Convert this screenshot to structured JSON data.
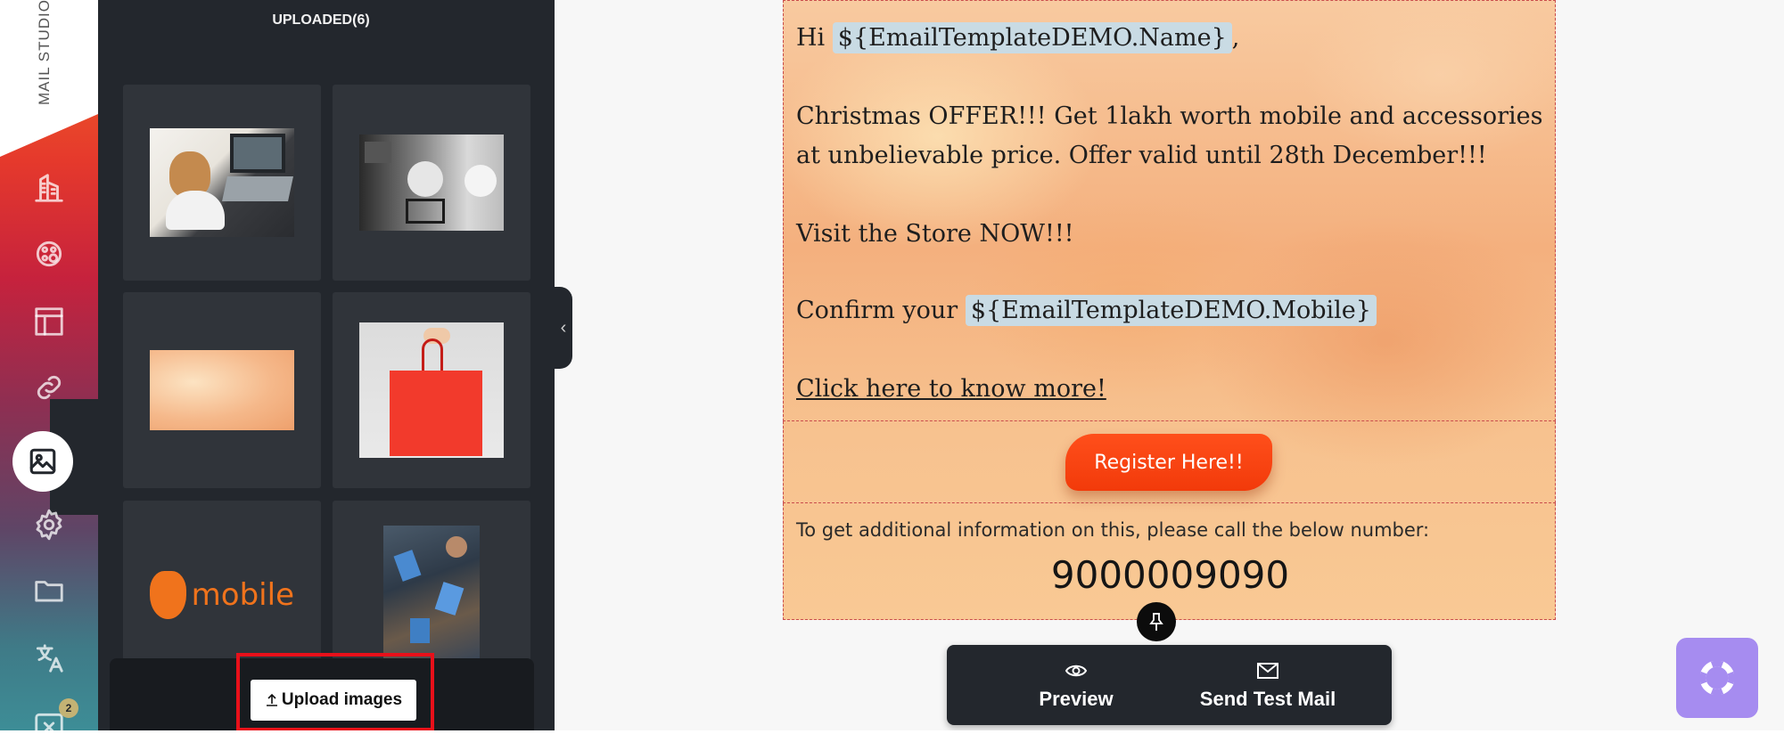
{
  "sidebar": {
    "brand": "MAIL STUDIO",
    "items": [
      {
        "name": "templates-icon"
      },
      {
        "name": "palette-icon"
      },
      {
        "name": "layout-icon"
      },
      {
        "name": "link-icon"
      },
      {
        "name": "image-icon",
        "active": true
      },
      {
        "name": "gear-icon"
      },
      {
        "name": "folder-icon"
      },
      {
        "name": "translate-icon"
      },
      {
        "name": "variables-icon",
        "badge": "2"
      }
    ]
  },
  "panel": {
    "title": "UPLOADED(6)",
    "images": [
      {
        "name": "woman-laptop-thumbnail"
      },
      {
        "name": "office-desk-thumbnail"
      },
      {
        "name": "orange-background-thumbnail"
      },
      {
        "name": "red-shopping-bag-thumbnail"
      },
      {
        "name": "mobile-logo-thumbnail",
        "text": "mobile"
      },
      {
        "name": "team-tablets-thumbnail"
      }
    ],
    "upload_label": "Upload images",
    "upload_icon": "upload-icon"
  },
  "email": {
    "greeting": "Hi",
    "name_tag": "${EmailTemplateDEMO.Name}",
    "greeting_suffix": ",",
    "offer": "Christmas OFFER!!! Get 1lakh worth mobile and accessories at unbelievable price. Offer valid until 28th December!!!",
    "visit": "Visit the Store NOW!!!",
    "confirm": "Confirm your",
    "mobile_tag": "${EmailTemplateDEMO.Mobile}",
    "link": "Click here to know more!",
    "button": "Register Here!!",
    "info": "To get additional information on this, please call the below number:",
    "phone": "9000009090"
  },
  "actions": {
    "preview": "Preview",
    "send": "Send Test Mail"
  },
  "colors": {
    "panel_bg": "#23272d",
    "cta": "#f23a0a",
    "help": "#a68cf0",
    "highlight": "#e8101a"
  }
}
